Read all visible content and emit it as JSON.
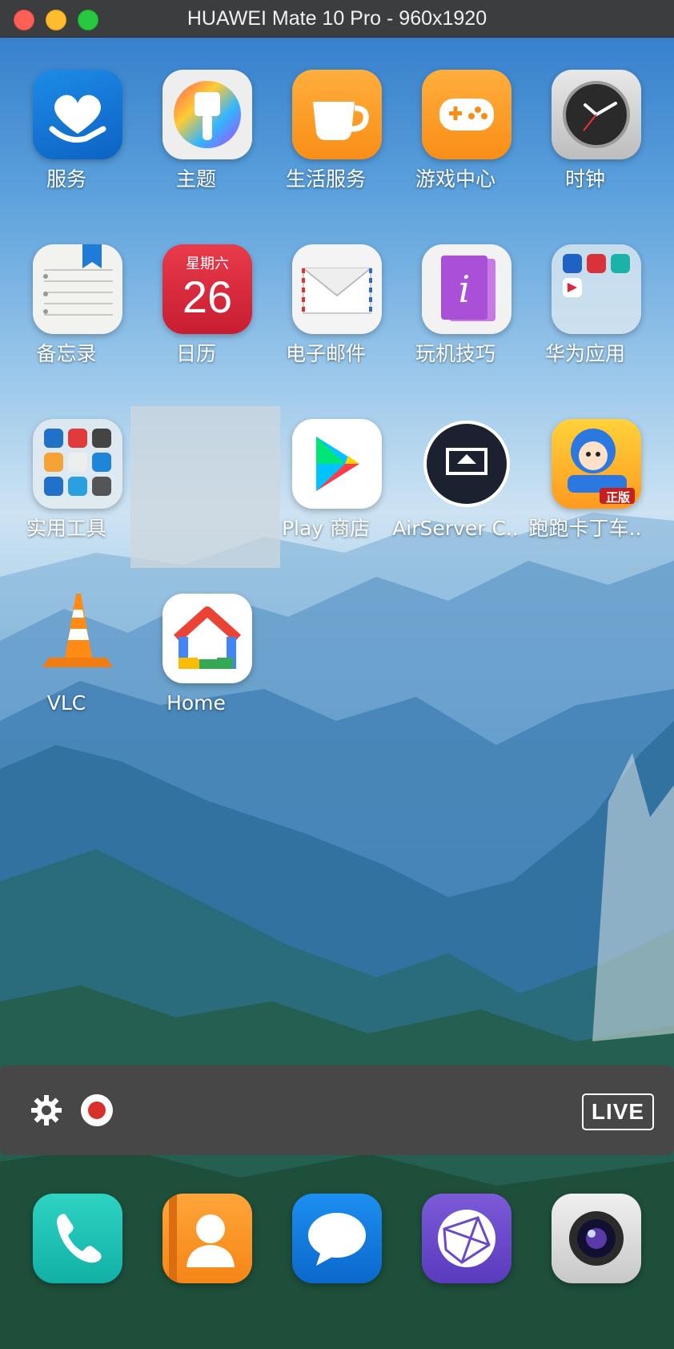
{
  "window": {
    "title": "HUAWEI Mate 10 Pro - 960x1920"
  },
  "apps": [
    {
      "label": "服务"
    },
    {
      "label": "主题"
    },
    {
      "label": "生活服务"
    },
    {
      "label": "游戏中心"
    },
    {
      "label": "时钟"
    },
    {
      "label": "备忘录"
    },
    {
      "label": "日历",
      "weekday": "星期六",
      "day": "26"
    },
    {
      "label": "电子邮件"
    },
    {
      "label": "玩机技巧"
    },
    {
      "label": "华为应用"
    },
    {
      "label": "实用工具"
    },
    {
      "label": "Play 商店"
    },
    {
      "label": "AirServer C.."
    },
    {
      "label": "跑跑卡丁车.."
    },
    {
      "label": "VLC"
    },
    {
      "label": "Home"
    }
  ],
  "game_icon_badge": "正版",
  "toolbar": {
    "live_label": "LIVE"
  },
  "dock": [
    {
      "icon": "phone-icon"
    },
    {
      "icon": "contacts-icon"
    },
    {
      "icon": "messages-icon"
    },
    {
      "icon": "browser-icon"
    },
    {
      "icon": "camera-icon"
    }
  ],
  "colors": {
    "record": "#d9312a",
    "titlebar": "#3c3d3f",
    "toolbar": "#474747"
  }
}
